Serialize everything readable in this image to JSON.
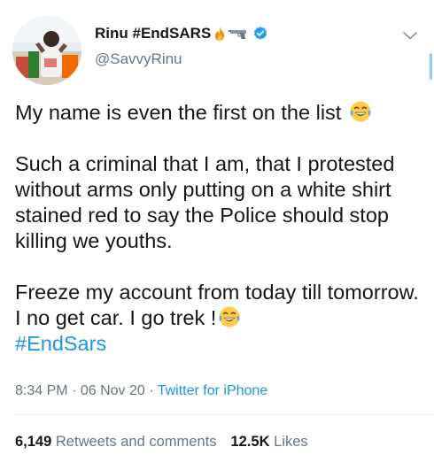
{
  "tweet": {
    "author": {
      "display_name": "Rinu #EndSARS",
      "handle": "@SavvyRinu",
      "name_emoji_icons": [
        "fire-icon",
        "pistol-icon"
      ],
      "verified": true
    },
    "paragraphs": [
      {
        "text": "My name is even the first on the list",
        "emoji": "laughing-tears-icon"
      },
      {
        "text": "Such a criminal that I am, that I protested without arms only putting on a white shirt stained red to say the Police should stop killing we youths."
      },
      {
        "text": "Freeze my account from today till tomorrow. I no get car. I go trek !",
        "emoji": "laughing-tears-icon"
      }
    ],
    "hashtag": "#EndSars",
    "time": "8:34 PM",
    "date": "06 Nov 20",
    "separator": "·",
    "source": "Twitter for iPhone",
    "retweets": {
      "count": "6,149",
      "label": "Retweets and comments"
    },
    "likes": {
      "count": "12.5K",
      "label": "Likes"
    }
  },
  "colors": {
    "text": "#14171a",
    "secondary": "#657786",
    "link": "#1b95e0",
    "verified": "#1da1f2",
    "divider": "#e6ecf0"
  }
}
